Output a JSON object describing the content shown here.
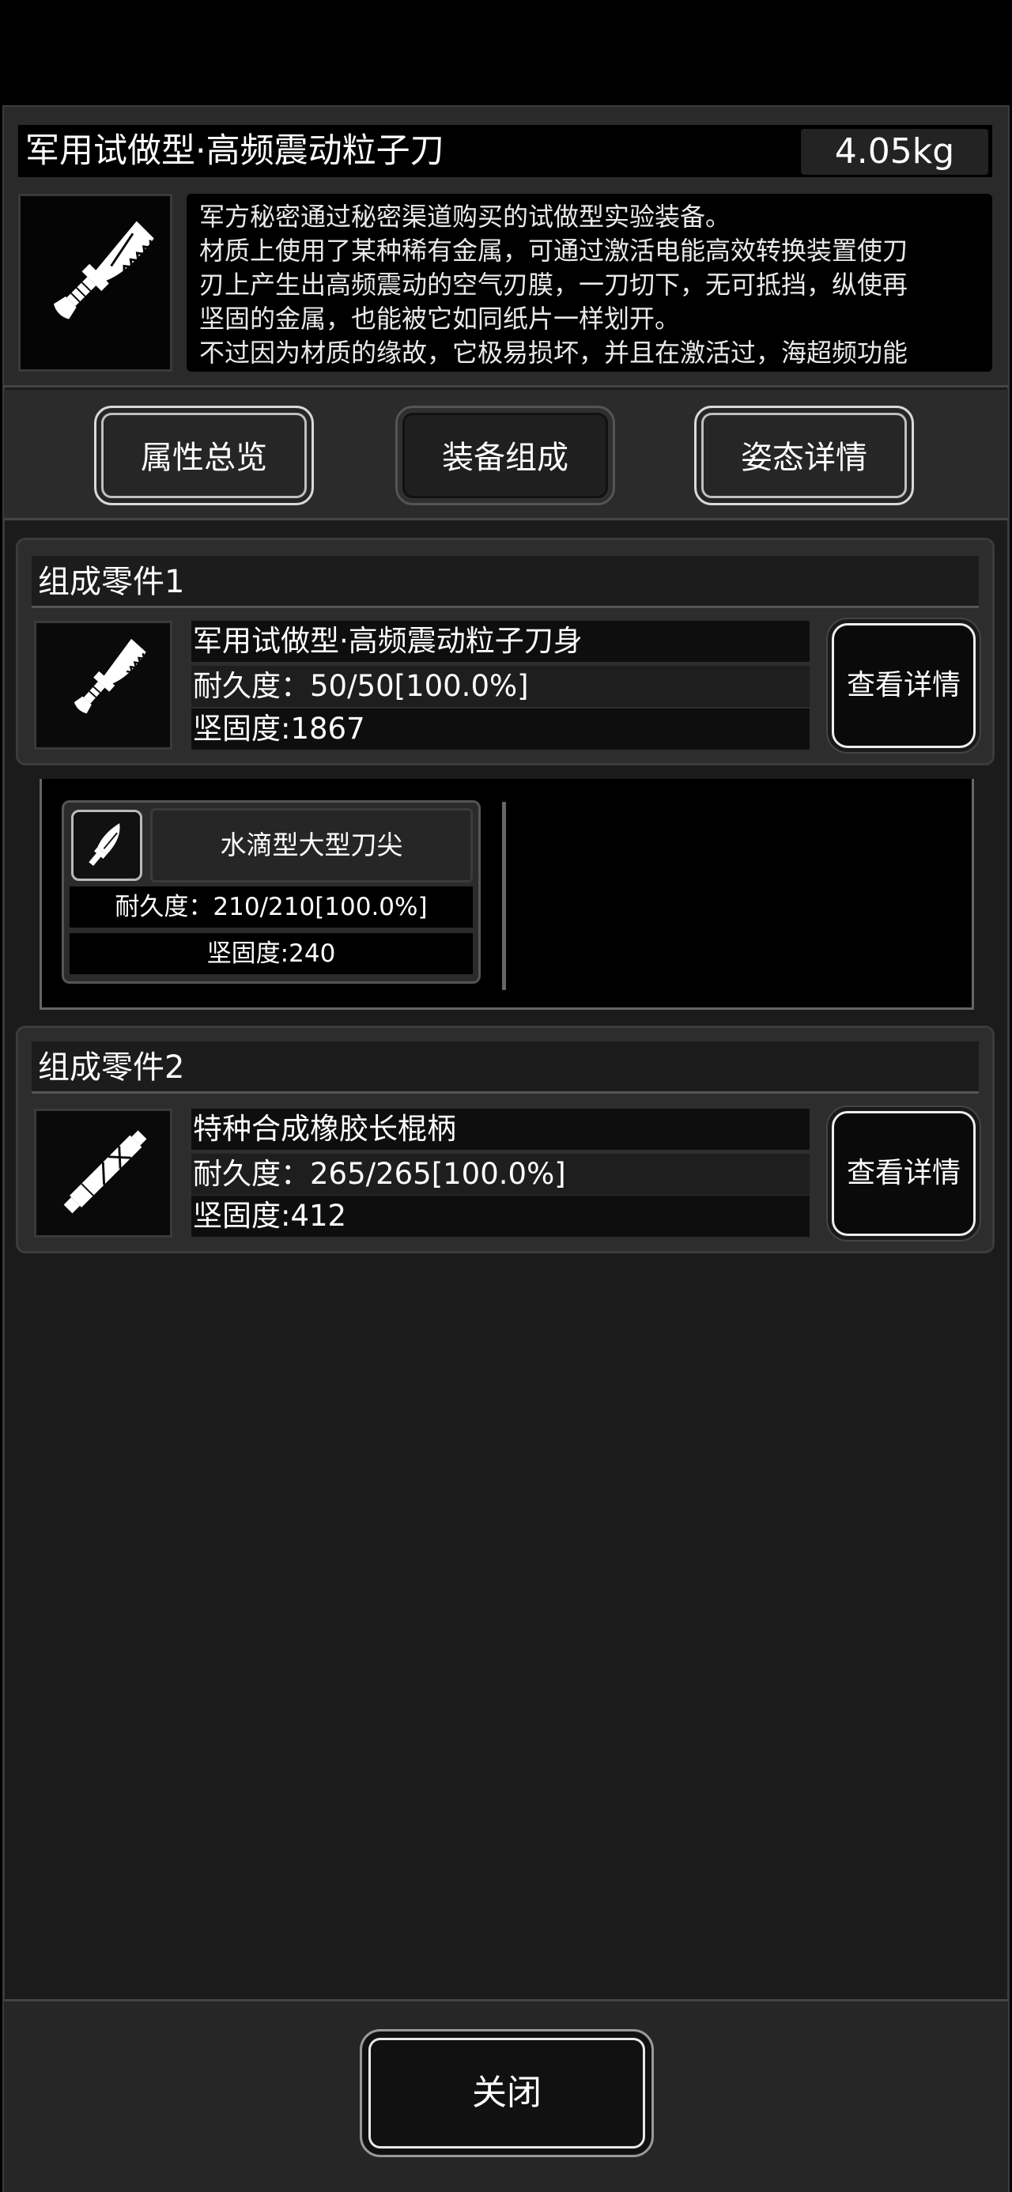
{
  "item": {
    "title": "军用试做型·高频震动粒子刀",
    "weight": "4.05kg",
    "description_lines": [
      "军方秘密通过秘密渠道购买的试做型实验装备。",
      "材质上使用了某种稀有金属，可通过激活电能高效转换装置使刀",
      "刃上产生出高频震动的空气刃膜，一刀切下，无可抵挡，纵使再",
      "坚固的金属，也能被它如同纸片一样划开。",
      "不过因为材质的缘故，它极易损坏，并且在激活过，海超频功能"
    ],
    "icon": "knife-icon"
  },
  "tabs": [
    {
      "label": "属性总览"
    },
    {
      "label": "装备组成"
    },
    {
      "label": "姿态详情"
    }
  ],
  "parts": [
    {
      "header": "组成零件1",
      "name": "军用试做型·高频震动粒子刀身",
      "durability": "耐久度：50/50[100.0%]",
      "hardness": "坚固度:1867",
      "detail_button": "查看详情",
      "icon": "knife-blade-icon"
    },
    {
      "header": "组成零件2",
      "name": "特种合成橡胶长棍柄",
      "durability": "耐久度：265/265[100.0%]",
      "hardness": "坚固度:412",
      "detail_button": "查看详情",
      "icon": "handle-icon"
    }
  ],
  "subpart": {
    "name": "水滴型大型刀尖",
    "durability": "耐久度：210/210[100.0%]",
    "hardness": "坚固度:240",
    "icon": "blade-tip-icon"
  },
  "close_button": "关闭"
}
